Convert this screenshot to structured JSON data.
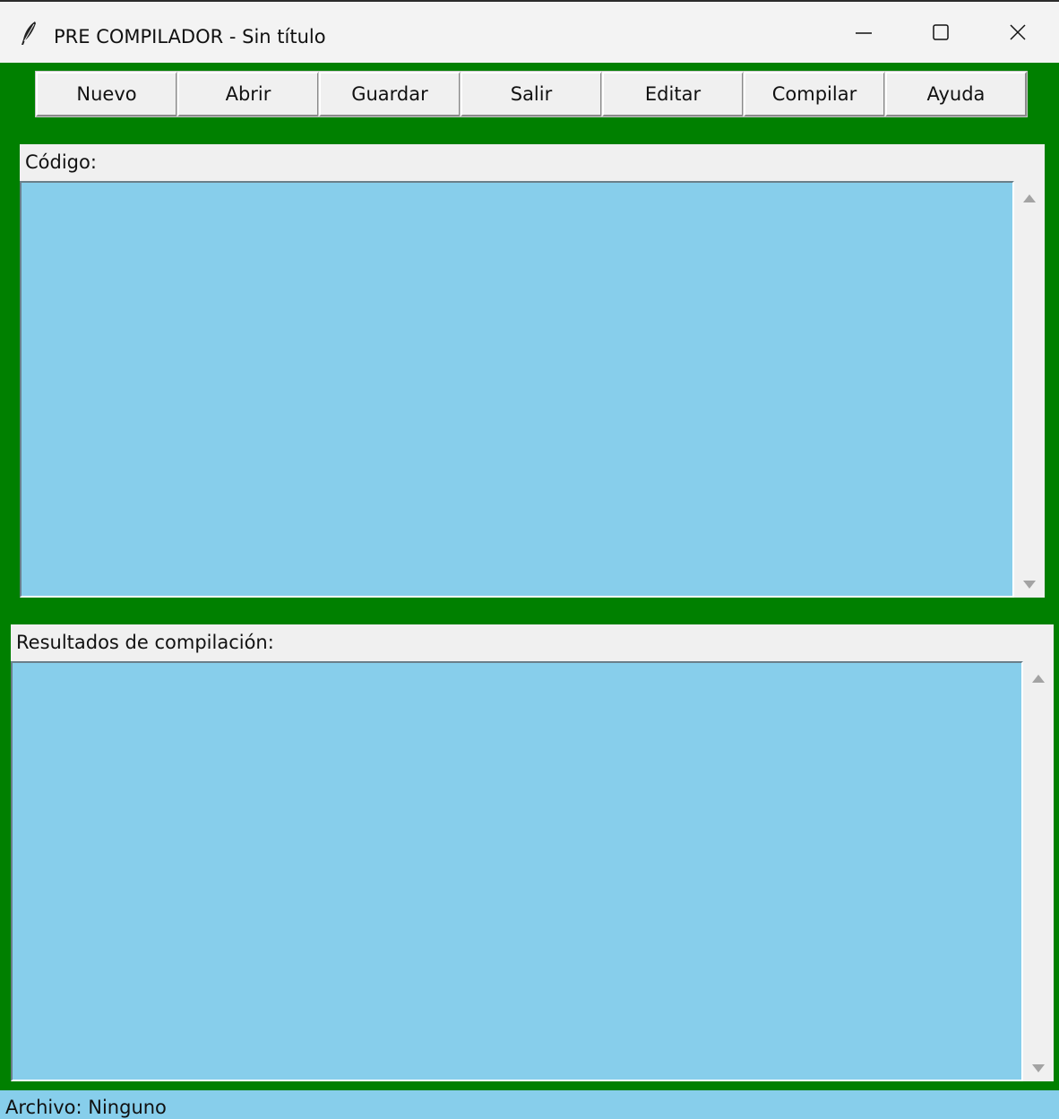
{
  "window": {
    "title": "PRE COMPILADOR - Sin título",
    "controls": {
      "minimize_icon": "minimize-icon",
      "maximize_icon": "maximize-icon",
      "close_icon": "close-icon"
    }
  },
  "toolbar": {
    "buttons": [
      {
        "label": "Nuevo"
      },
      {
        "label": "Abrir"
      },
      {
        "label": "Guardar"
      },
      {
        "label": "Salir"
      },
      {
        "label": "Editar"
      },
      {
        "label": "Compilar"
      },
      {
        "label": "Ayuda"
      }
    ]
  },
  "code_panel": {
    "label": "Código:",
    "content": ""
  },
  "results_panel": {
    "label": "Resultados de compilación:",
    "content": ""
  },
  "status": {
    "text": "Archivo: Ninguno"
  },
  "colors": {
    "background": "#008000",
    "text_area": "#87ceeb",
    "status_bar": "#87ceeb",
    "panel": "#f0f0f0"
  }
}
